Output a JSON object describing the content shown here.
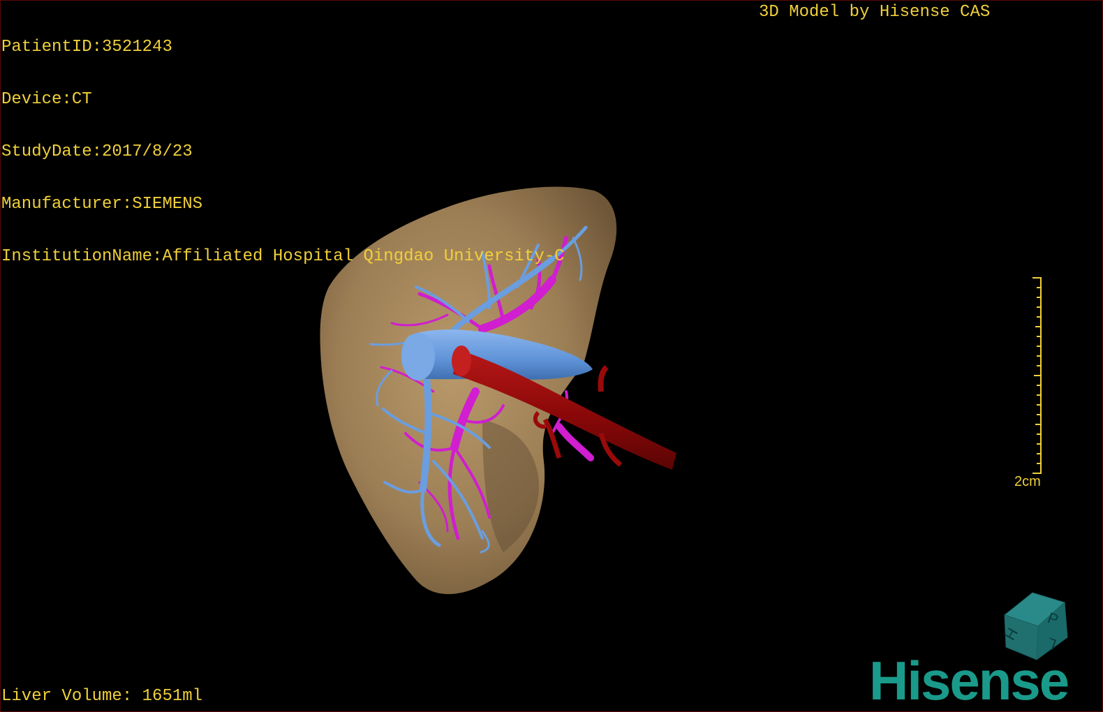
{
  "overlay": {
    "patient_id": "PatientID:3521243",
    "device": "Device:CT",
    "study_date": "StudyDate:2017/8/23",
    "manufacturer": "Manufacturer:SIEMENS",
    "institution": "InstitutionName:Affiliated Hospital Qingdao University-C",
    "model_credit": "3D Model by Hisense CAS",
    "liver_volume": "Liver Volume: 1651ml",
    "scale_label": "2cm"
  },
  "orientation_cube": {
    "faces": [
      "P",
      "H",
      "L"
    ]
  },
  "brand": {
    "logo_text": "Hisense"
  },
  "colors": {
    "overlay_text": "#f0d03a",
    "liver": "#a98a5e",
    "portal_vein": "#6a9ee0",
    "hepatic_vein": "#d01ed0",
    "aorta": "#9a0a0a",
    "brand": "#1a9a8a"
  }
}
